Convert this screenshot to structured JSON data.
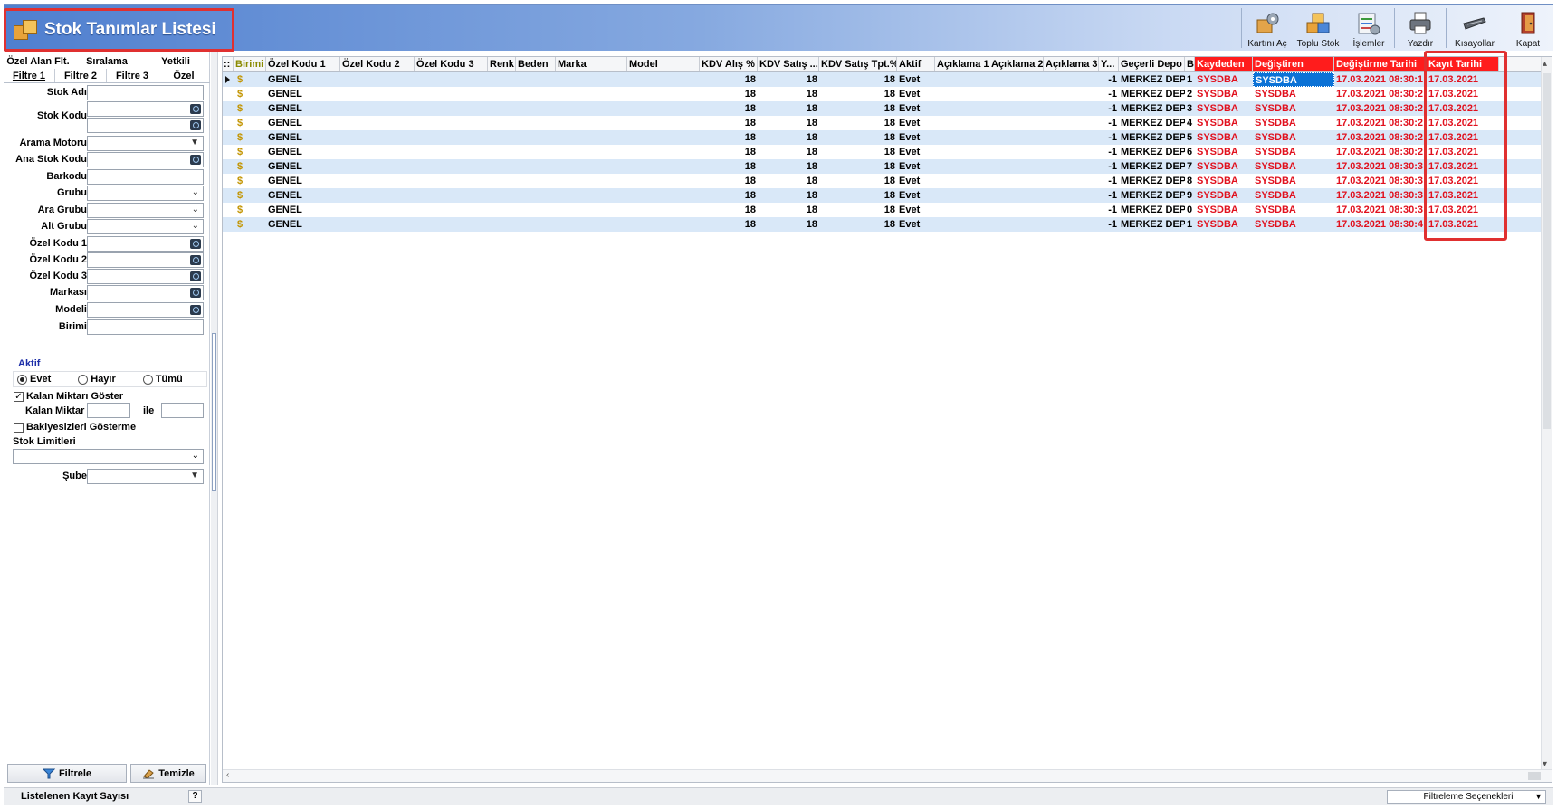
{
  "window": {
    "title": "Stok Tanımlar Listesi"
  },
  "toolbar": {
    "open_card": "Kartını Aç",
    "bulk_stock": "Toplu Stok",
    "operations": "İşlemler",
    "print": "Yazdır",
    "shortcuts": "Kısayollar",
    "close": "Kapat"
  },
  "filter_tabs": {
    "row1": [
      "Özel Alan Flt.",
      "Sıralama",
      "Yetkili"
    ],
    "row2": [
      "Filtre 1",
      "Filtre 2",
      "Filtre 3",
      "Özel"
    ]
  },
  "filters": {
    "stok_adi": "Stok Adı",
    "stok_kodu": "Stok Kodu",
    "arama_motoru": "Arama Motoru",
    "ana_stok_kodu": "Ana Stok Kodu",
    "barkodu": "Barkodu",
    "grubu": "Grubu",
    "ara_grubu": "Ara Grubu",
    "alt_grubu": "Alt Grubu",
    "ozel_kodu_1": "Özel Kodu 1",
    "ozel_kodu_2": "Özel Kodu 2",
    "ozel_kodu_3": "Özel Kodu 3",
    "markasi": "Markası",
    "modeli": "Modeli",
    "birimi": "Birimi",
    "aktif_title": "Aktif",
    "aktif_options": [
      "Evet",
      "Hayır",
      "Tümü"
    ],
    "kalan_miktari_goster": "Kalan Miktarı Göster",
    "kalan_miktar": "Kalan Miktar",
    "ile": "ile",
    "bakiyesizleri_gosterme": "Bakiyesizleri Gösterme",
    "stok_limitleri": "Stok Limitleri",
    "sube": "Şube"
  },
  "buttons": {
    "filter": "Filtrele",
    "clear": "Temizle"
  },
  "grid": {
    "headers": {
      "marker": "::",
      "birimi": "Birimi",
      "ozel1": "Özel Kodu 1",
      "ozel2": "Özel Kodu 2",
      "ozel3": "Özel Kodu 3",
      "renk": "Renk",
      "beden": "Beden",
      "marka": "Marka",
      "model": "Model",
      "kdv_alis": "KDV Alış %",
      "kdv_satis": "KDV Satış ...",
      "kdv_tpt": "KDV Satış Tpt.%",
      "aktif": "Aktif",
      "acik1": "Açıklama 1",
      "acik2": "Açıklama 2",
      "acik3": "Açıklama 3",
      "y": "Y...",
      "depo": "Geçerli Depo",
      "b": "B",
      "kaydeden": "Kaydeden",
      "degistiren": "Değiştiren",
      "degistirme": "Değiştirme Tarihi",
      "kayit": "Kayıt Tarihi"
    },
    "rows": [
      {
        "birimi": "$",
        "ozel1": "GENEL",
        "kdv_alis": "18",
        "kdv_satis": "18",
        "kdv_tpt": "18",
        "aktif": "Evet",
        "y": "-1",
        "depo": "MERKEZ DEPO",
        "b": "1",
        "kaydeden": "SYSDBA",
        "degistiren": "SYSDBA",
        "degistirme": "17.03.2021 08:30:1",
        "kayit": "17.03.2021"
      },
      {
        "birimi": "$",
        "ozel1": "GENEL",
        "kdv_alis": "18",
        "kdv_satis": "18",
        "kdv_tpt": "18",
        "aktif": "Evet",
        "y": "-1",
        "depo": "MERKEZ DEPO",
        "b": "2",
        "kaydeden": "SYSDBA",
        "degistiren": "SYSDBA",
        "degistirme": "17.03.2021 08:30:2",
        "kayit": "17.03.2021"
      },
      {
        "birimi": "$",
        "ozel1": "GENEL",
        "kdv_alis": "18",
        "kdv_satis": "18",
        "kdv_tpt": "18",
        "aktif": "Evet",
        "y": "-1",
        "depo": "MERKEZ DEPO",
        "b": "3",
        "kaydeden": "SYSDBA",
        "degistiren": "SYSDBA",
        "degistirme": "17.03.2021 08:30:2",
        "kayit": "17.03.2021"
      },
      {
        "birimi": "$",
        "ozel1": "GENEL",
        "kdv_alis": "18",
        "kdv_satis": "18",
        "kdv_tpt": "18",
        "aktif": "Evet",
        "y": "-1",
        "depo": "MERKEZ DEPO",
        "b": "4",
        "kaydeden": "SYSDBA",
        "degistiren": "SYSDBA",
        "degistirme": "17.03.2021 08:30:2",
        "kayit": "17.03.2021"
      },
      {
        "birimi": "$",
        "ozel1": "GENEL",
        "kdv_alis": "18",
        "kdv_satis": "18",
        "kdv_tpt": "18",
        "aktif": "Evet",
        "y": "-1",
        "depo": "MERKEZ DEPO",
        "b": "5",
        "kaydeden": "SYSDBA",
        "degistiren": "SYSDBA",
        "degistirme": "17.03.2021 08:30:2",
        "kayit": "17.03.2021"
      },
      {
        "birimi": "$",
        "ozel1": "GENEL",
        "kdv_alis": "18",
        "kdv_satis": "18",
        "kdv_tpt": "18",
        "aktif": "Evet",
        "y": "-1",
        "depo": "MERKEZ DEPO",
        "b": "6",
        "kaydeden": "SYSDBA",
        "degistiren": "SYSDBA",
        "degistirme": "17.03.2021 08:30:2",
        "kayit": "17.03.2021"
      },
      {
        "birimi": "$",
        "ozel1": "GENEL",
        "kdv_alis": "18",
        "kdv_satis": "18",
        "kdv_tpt": "18",
        "aktif": "Evet",
        "y": "-1",
        "depo": "MERKEZ DEPO",
        "b": "7",
        "kaydeden": "SYSDBA",
        "degistiren": "SYSDBA",
        "degistirme": "17.03.2021 08:30:3",
        "kayit": "17.03.2021"
      },
      {
        "birimi": "$",
        "ozel1": "GENEL",
        "kdv_alis": "18",
        "kdv_satis": "18",
        "kdv_tpt": "18",
        "aktif": "Evet",
        "y": "-1",
        "depo": "MERKEZ DEPO",
        "b": "8",
        "kaydeden": "SYSDBA",
        "degistiren": "SYSDBA",
        "degistirme": "17.03.2021 08:30:3",
        "kayit": "17.03.2021"
      },
      {
        "birimi": "$",
        "ozel1": "GENEL",
        "kdv_alis": "18",
        "kdv_satis": "18",
        "kdv_tpt": "18",
        "aktif": "Evet",
        "y": "-1",
        "depo": "MERKEZ DEPO",
        "b": "9",
        "kaydeden": "SYSDBA",
        "degistiren": "SYSDBA",
        "degistirme": "17.03.2021 08:30:3",
        "kayit": "17.03.2021"
      },
      {
        "birimi": "$",
        "ozel1": "GENEL",
        "kdv_alis": "18",
        "kdv_satis": "18",
        "kdv_tpt": "18",
        "aktif": "Evet",
        "y": "-1",
        "depo": "MERKEZ DEPO",
        "b": "0",
        "kaydeden": "SYSDBA",
        "degistiren": "SYSDBA",
        "degistirme": "17.03.2021 08:30:3",
        "kayit": "17.03.2021"
      },
      {
        "birimi": "$",
        "ozel1": "GENEL",
        "kdv_alis": "18",
        "kdv_satis": "18",
        "kdv_tpt": "18",
        "aktif": "Evet",
        "y": "-1",
        "depo": "MERKEZ DEPO",
        "b": "1",
        "kaydeden": "SYSDBA",
        "degistiren": "SYSDBA",
        "degistirme": "17.03.2021 08:30:4",
        "kayit": "17.03.2021"
      }
    ]
  },
  "status": {
    "record_count_label": "Listelenen Kayıt Sayısı",
    "help": "?",
    "filter_options": "Filtreleme Seçenekleri"
  },
  "colors": {
    "header_blue": "#4f7fcf",
    "highlight_red": "#e03030",
    "row_alt": "#d9e8f8",
    "selection": "#0b72d6"
  }
}
